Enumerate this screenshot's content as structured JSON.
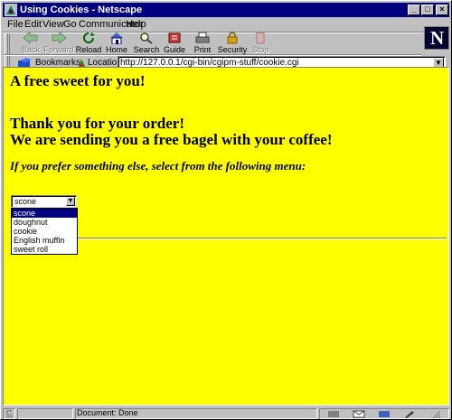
{
  "window": {
    "title": "Using Cookies - Netscape"
  },
  "menu": [
    "File",
    "Edit",
    "View",
    "Go",
    "Communicator",
    "Help"
  ],
  "toolbar": [
    {
      "label": "Back",
      "icon": "back-arrow-icon",
      "enabled": false
    },
    {
      "label": "Forward",
      "icon": "forward-arrow-icon",
      "enabled": false
    },
    {
      "label": "Reload",
      "icon": "reload-icon",
      "enabled": true
    },
    {
      "label": "Home",
      "icon": "home-icon",
      "enabled": true
    },
    {
      "label": "Search",
      "icon": "search-icon",
      "enabled": true
    },
    {
      "label": "Guide",
      "icon": "guide-icon",
      "enabled": true
    },
    {
      "label": "Print",
      "icon": "print-icon",
      "enabled": true
    },
    {
      "label": "Security",
      "icon": "security-lock-icon",
      "enabled": true
    },
    {
      "label": "Stop",
      "icon": "stop-icon",
      "enabled": false
    }
  ],
  "location": {
    "bookmarks_label": "Bookmarks",
    "location_label": "Location:",
    "url": "http://127.0.0.1/cgi-bin/cgipm-stuff/cookie.cgi"
  },
  "page": {
    "heading1": "A free sweet for you!",
    "heading2": "Thank you for your order!",
    "heading3": "We are sending you a free bagel with your coffee!",
    "prompt": "If you prefer something else, select from the following menu:",
    "select": {
      "value": "scone",
      "options": [
        "scone",
        "doughnut",
        "cookie",
        "English muffin",
        "sweet roll"
      ],
      "highlighted": "scone"
    }
  },
  "status": {
    "text": "Document: Done"
  },
  "colors": {
    "page_background": "#ffff00",
    "titlebar": "#000080",
    "chrome": "#c0c0c0"
  }
}
